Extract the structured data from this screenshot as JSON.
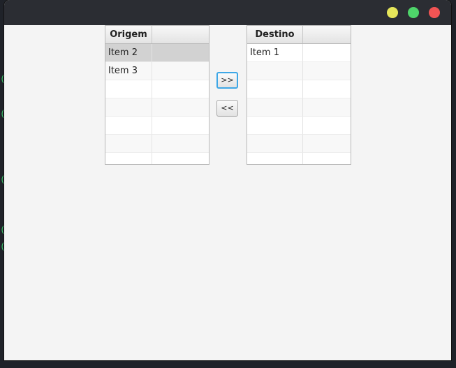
{
  "window": {
    "controls": [
      {
        "name": "minimize",
        "color": "#e6e65a"
      },
      {
        "name": "maximize",
        "color": "#4ed46a"
      },
      {
        "name": "close",
        "color": "#f25454"
      }
    ]
  },
  "source_table": {
    "column_headers": [
      "Origem",
      ""
    ],
    "rows": [
      {
        "values": [
          "Item 2",
          ""
        ],
        "selected": true
      },
      {
        "values": [
          "Item 3",
          ""
        ],
        "selected": false
      },
      {
        "values": [
          "",
          ""
        ],
        "selected": false
      },
      {
        "values": [
          "",
          ""
        ],
        "selected": false
      },
      {
        "values": [
          "",
          ""
        ],
        "selected": false
      },
      {
        "values": [
          "",
          ""
        ],
        "selected": false
      },
      {
        "values": [
          "",
          ""
        ],
        "selected": false
      }
    ]
  },
  "dest_table": {
    "column_headers": [
      "Destino",
      ""
    ],
    "rows": [
      {
        "values": [
          "Item 1",
          ""
        ],
        "selected": false
      },
      {
        "values": [
          "",
          ""
        ],
        "selected": false
      },
      {
        "values": [
          "",
          ""
        ],
        "selected": false
      },
      {
        "values": [
          "",
          ""
        ],
        "selected": false
      },
      {
        "values": [
          "",
          ""
        ],
        "selected": false
      },
      {
        "values": [
          "",
          ""
        ],
        "selected": false
      },
      {
        "values": [
          "",
          ""
        ],
        "selected": false
      }
    ]
  },
  "buttons": {
    "move_right_label": ">>",
    "move_left_label": "<<"
  },
  "colors": {
    "focus_ring": "#3ea7e6",
    "selection": "#d2d2d2"
  }
}
